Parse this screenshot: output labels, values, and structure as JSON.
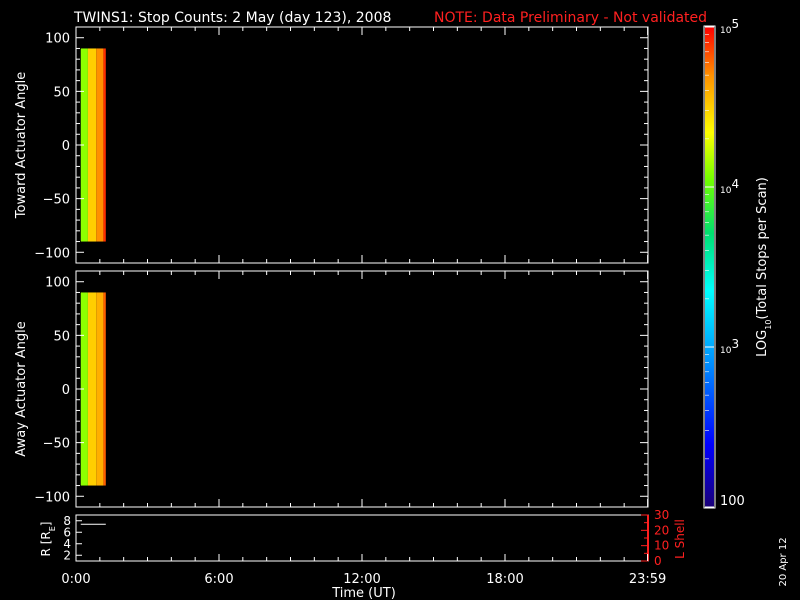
{
  "header": {
    "title": "TWINS1: Stop Counts:  2 May (day 123), 2008",
    "note": "NOTE: Data Preliminary - Not validated",
    "note_color": "#ff2020"
  },
  "date_stamp": "20 Apr 12",
  "chart_data": [
    {
      "type": "heatmap",
      "id": "toward",
      "ylabel": "Toward Actuator Angle",
      "ylim": [
        -110,
        110
      ],
      "yticks": [
        100,
        50,
        0,
        -50,
        -100
      ],
      "ytick_labels": [
        "100",
        "50",
        "0",
        "−50",
        "−100"
      ],
      "xlim": [
        0,
        24
      ],
      "angle_range": [
        -90,
        90
      ],
      "cells": [
        {
          "t0": 0.2,
          "t1": 0.5,
          "value": 4.1
        },
        {
          "t0": 0.5,
          "t1": 0.85,
          "value": 4.5
        },
        {
          "t0": 0.85,
          "t1": 1.15,
          "value": 4.7
        },
        {
          "t0": 1.15,
          "t1": 1.25,
          "value": 4.9
        }
      ]
    },
    {
      "type": "heatmap",
      "id": "away",
      "ylabel": "Away Actuator Angle",
      "ylim": [
        -110,
        110
      ],
      "yticks": [
        100,
        50,
        0,
        -50,
        -100
      ],
      "ytick_labels": [
        "100",
        "50",
        "0",
        "−50",
        "−100"
      ],
      "xlim": [
        0,
        24
      ],
      "angle_range": [
        -90,
        90
      ],
      "cells": [
        {
          "t0": 0.2,
          "t1": 0.5,
          "value": 4.1
        },
        {
          "t0": 0.5,
          "t1": 0.85,
          "value": 4.5
        },
        {
          "t0": 0.85,
          "t1": 1.15,
          "value": 4.6
        },
        {
          "t0": 1.15,
          "t1": 1.25,
          "value": 4.8
        }
      ]
    },
    {
      "type": "line",
      "id": "orbit",
      "ylabel_left": "R [R",
      "ylabel_left_sub": "E",
      "ylabel_left_end": "]",
      "ylim_left": [
        1,
        9
      ],
      "yticks_left": [
        2,
        4,
        6,
        8
      ],
      "ytick_labels_left": [
        "2",
        "4",
        "6",
        "8"
      ],
      "ylabel_right": "L Shell",
      "ylim_right": [
        0,
        30
      ],
      "yticks_right": [
        0,
        10,
        20,
        30
      ],
      "ytick_labels_right": [
        "0",
        "10",
        "20",
        "30"
      ],
      "right_axis_color": "#ff2020",
      "xlabel": "Time (UT)",
      "xlim": [
        0,
        24
      ],
      "xticks": [
        0,
        6,
        12,
        18,
        23.983
      ],
      "xtick_labels": [
        "0:00",
        "6:00",
        "12:00",
        "18:00",
        "23:59"
      ],
      "series": [
        {
          "x": [
            0.2,
            1.25
          ],
          "y": [
            7.4,
            7.4
          ]
        }
      ]
    }
  ],
  "colorbar": {
    "label": "LOG",
    "label_sub": "10",
    "label_rest": "(Total Stops per Scan)",
    "range": [
      2,
      5
    ],
    "ticks": [
      {
        "value": 5,
        "base": "10",
        "exp": "5"
      },
      {
        "value": 4,
        "base": "10",
        "exp": "4"
      },
      {
        "value": 3,
        "base": "10",
        "exp": "3"
      },
      {
        "value": 2,
        "label": "100"
      }
    ]
  }
}
